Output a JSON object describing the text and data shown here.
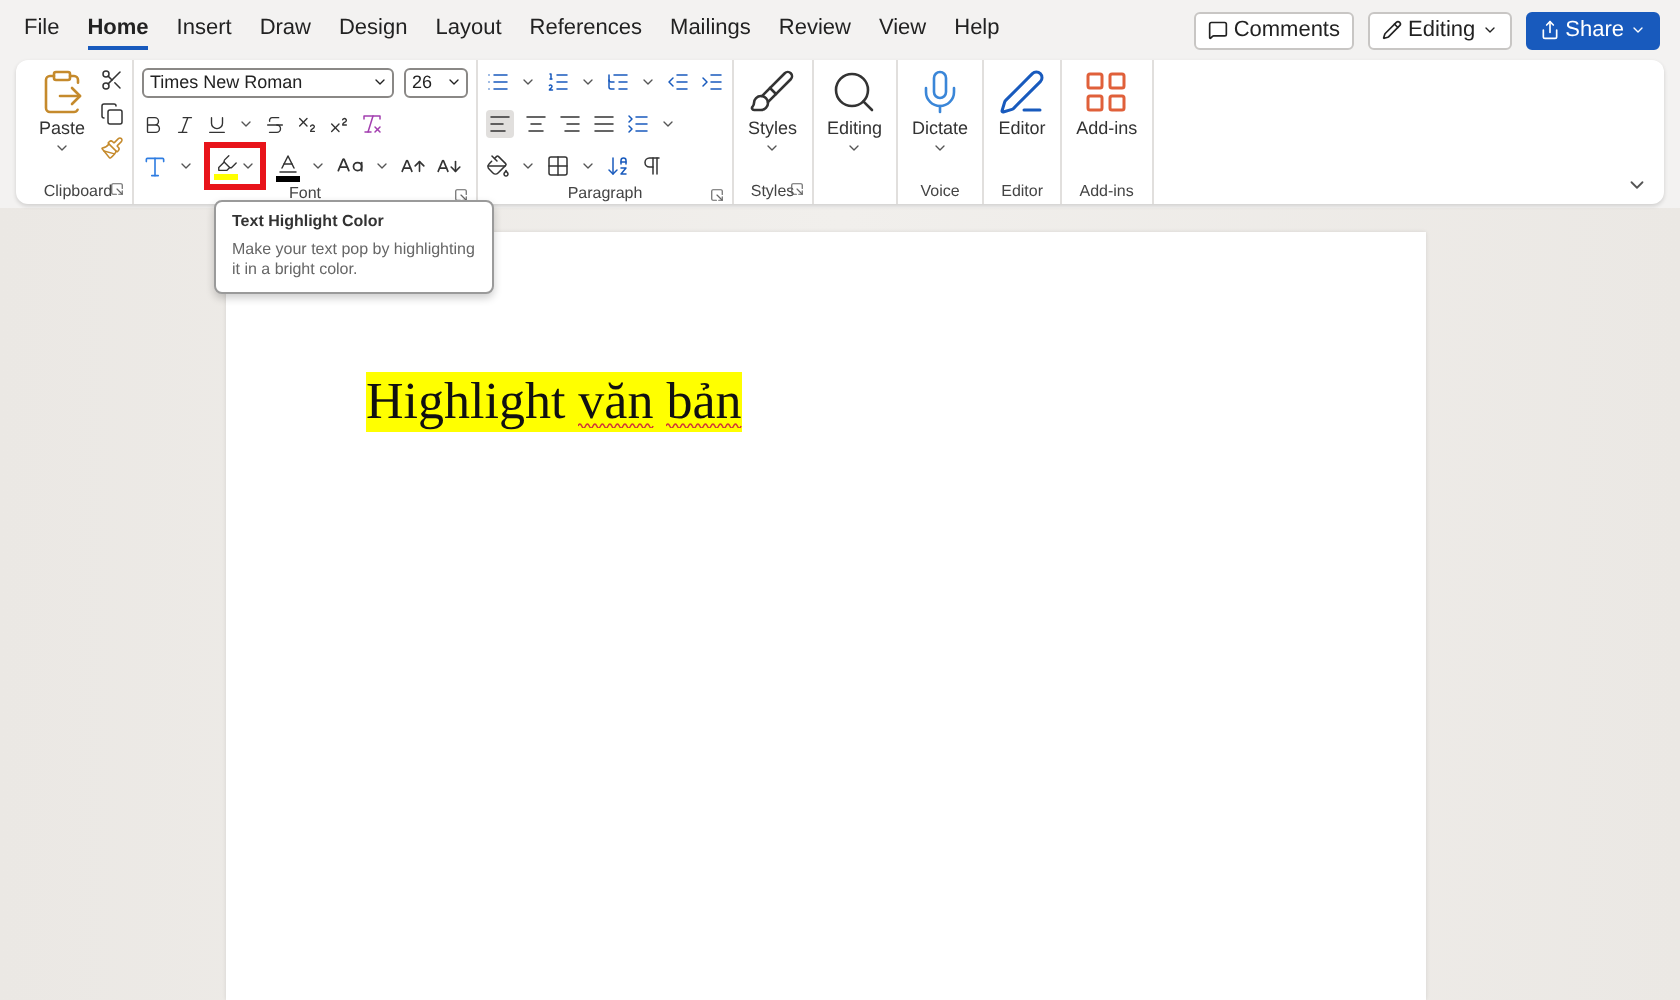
{
  "menu": {
    "tabs": [
      {
        "label": "File",
        "selected": false
      },
      {
        "label": "Home",
        "selected": true
      },
      {
        "label": "Insert",
        "selected": false
      },
      {
        "label": "Draw",
        "selected": false
      },
      {
        "label": "Design",
        "selected": false
      },
      {
        "label": "Layout",
        "selected": false
      },
      {
        "label": "References",
        "selected": false
      },
      {
        "label": "Mailings",
        "selected": false
      },
      {
        "label": "Review",
        "selected": false
      },
      {
        "label": "View",
        "selected": false
      },
      {
        "label": "Help",
        "selected": false
      }
    ]
  },
  "top_actions": [
    {
      "kind": "comments",
      "label": "Comments"
    },
    {
      "kind": "editing",
      "label": "Editing"
    },
    {
      "kind": "share",
      "label": "Share"
    }
  ],
  "ribbon": {
    "font": {
      "name": "Times New Roman",
      "size": "26"
    },
    "highlight_button": {
      "annotated": true
    },
    "groups": [
      {
        "kind": "clipboard",
        "label": "Clipboard",
        "launcher": true,
        "button": {
          "label": "Paste",
          "dropdown": true
        }
      },
      {
        "kind": "font",
        "label": "Font",
        "launcher": true
      },
      {
        "kind": "paragraph",
        "label": "Paragraph",
        "launcher": true
      },
      {
        "kind": "styles",
        "label": "Styles",
        "launcher": true,
        "button": {
          "label": "Styles",
          "dropdown": true
        }
      },
      {
        "kind": "editing",
        "launcher": false,
        "button": {
          "label": "Editing",
          "dropdown": true
        }
      },
      {
        "kind": "voice",
        "label": "Voice",
        "launcher": false,
        "button": {
          "label": "Dictate",
          "dropdown": true
        }
      },
      {
        "kind": "editor",
        "label": "Editor",
        "launcher": false,
        "button": {
          "label": "Editor",
          "dropdown": false
        }
      },
      {
        "kind": "addins",
        "label": "Add-ins",
        "launcher": false,
        "button": {
          "label": "Add-ins",
          "dropdown": false
        }
      }
    ]
  },
  "tooltip": {
    "title": "Text Highlight Color",
    "text": "Make your text pop by highlighting it in a bright color."
  },
  "document": {
    "lines": [
      {
        "highlighted": true,
        "words": [
          {
            "text": "Highlight",
            "misspelled": false
          },
          {
            "text": "văn",
            "misspelled": true
          },
          {
            "text": "bản",
            "misspelled": true
          }
        ]
      }
    ]
  }
}
